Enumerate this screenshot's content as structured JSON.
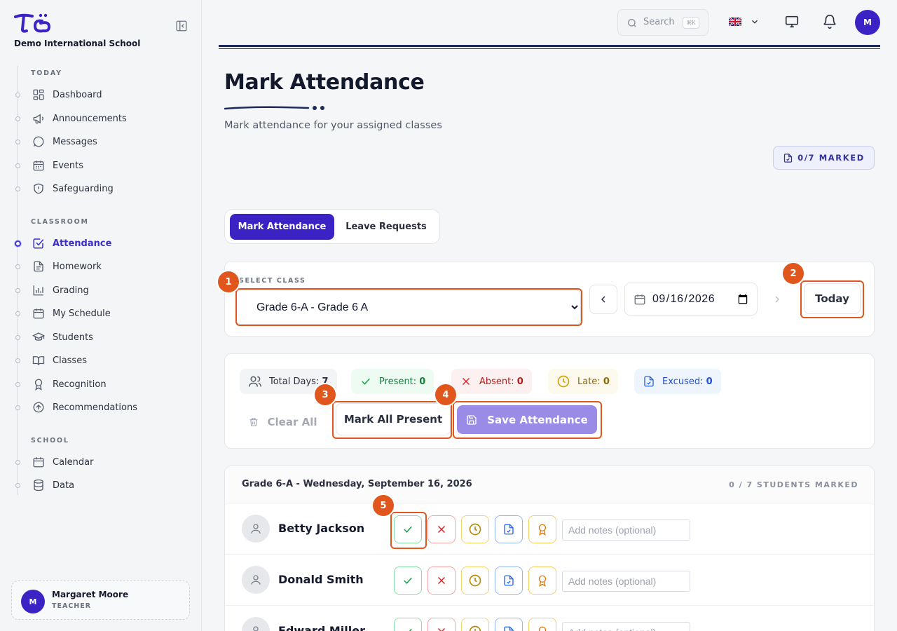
{
  "sidebar": {
    "school_name": "Demo International School",
    "sections": {
      "today": "TODAY",
      "classroom": "CLASSROOM",
      "school": "SCHOOL"
    },
    "items": [
      {
        "label": "Dashboard",
        "icon": "dashboard-icon"
      },
      {
        "label": "Announcements",
        "icon": "megaphone-icon"
      },
      {
        "label": "Messages",
        "icon": "chat-bubble-icon"
      },
      {
        "label": "Events",
        "icon": "calendar-icon"
      },
      {
        "label": "Safeguarding",
        "icon": "shield-icon"
      },
      {
        "label": "Attendance",
        "icon": "checkbox-icon",
        "active": true
      },
      {
        "label": "Homework",
        "icon": "document-icon"
      },
      {
        "label": "Grading",
        "icon": "bar-chart-icon"
      },
      {
        "label": "My Schedule",
        "icon": "calendar-icon"
      },
      {
        "label": "Students",
        "icon": "graduation-cap-icon"
      },
      {
        "label": "Classes",
        "icon": "book-icon"
      },
      {
        "label": "Recognition",
        "icon": "award-icon"
      },
      {
        "label": "Recommendations",
        "icon": "arrow-up-circle-icon"
      },
      {
        "label": "Calendar",
        "icon": "calendar-icon"
      },
      {
        "label": "Data",
        "icon": "database-icon"
      }
    ],
    "user": {
      "initial": "M",
      "name": "Margaret Moore",
      "role": "TEACHER"
    }
  },
  "topbar": {
    "search_placeholder": "Search",
    "search_shortcut": "⌘K",
    "avatar_initial": "M"
  },
  "page": {
    "title": "Mark Attendance",
    "subtitle": "Mark attendance for your assigned classes",
    "marked_badge": "0/7 MARKED"
  },
  "tabs": {
    "mark_attendance": "Mark Attendance",
    "leave_requests": "Leave Requests"
  },
  "class_selector": {
    "label": "SELECT CLASS",
    "selected": "Grade 6-A - Grade 6 A",
    "date_value": "2026-09-16",
    "today_label": "Today"
  },
  "stats": {
    "total_days_label": "Total Days:",
    "total_days": "7",
    "present_label": "Present:",
    "present": "0",
    "absent_label": "Absent:",
    "absent": "0",
    "late_label": "Late:",
    "late": "0",
    "excused_label": "Excused:",
    "excused": "0"
  },
  "actions": {
    "clear_all": "Clear All",
    "mark_all_present": "Mark All Present",
    "save_attendance": "Save Attendance"
  },
  "annotations": [
    "1",
    "2",
    "3",
    "4",
    "5"
  ],
  "list": {
    "title": "Grade 6-A - Wednesday, September 16, 2026",
    "count": "0 / 7 STUDENTS MARKED",
    "notes_placeholder": "Add notes (optional)",
    "students": [
      {
        "name": "Betty Jackson"
      },
      {
        "name": "Donald Smith"
      },
      {
        "name": "Edward Miller"
      }
    ]
  },
  "colors": {
    "accent": "#3b22c4",
    "annotation": "#e0561c",
    "present": "#16a34a",
    "absent": "#dc2626",
    "late": "#b58a05",
    "excused": "#2563eb"
  }
}
